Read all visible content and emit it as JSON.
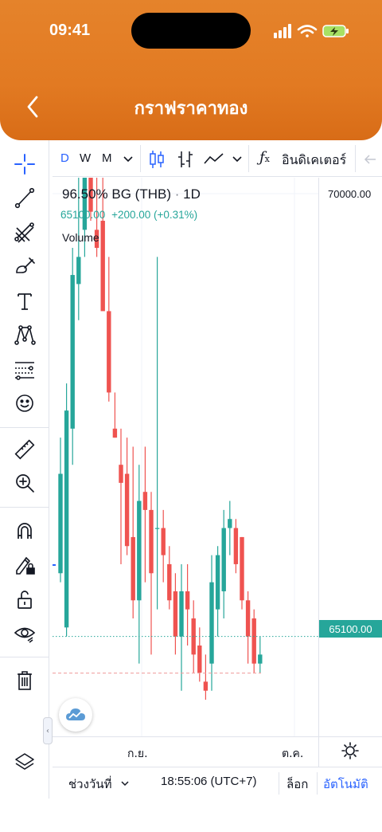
{
  "status_bar": {
    "time": "09:41"
  },
  "header": {
    "title": "กราฟราคาทอง",
    "back_icon": "chevron-left-icon"
  },
  "left_toolbar": {
    "tools": [
      "crosshair-icon",
      "trend-line-icon",
      "fib-icon",
      "brush-icon",
      "text-icon",
      "pattern-icon",
      "forecast-icon",
      "emoji-icon",
      "ruler-icon",
      "zoom-in-icon",
      "magnet-icon",
      "lock-drawing-icon",
      "unlock-icon",
      "eye-icon",
      "trash-icon",
      "layers-icon"
    ]
  },
  "top_toolbar": {
    "timeframes": [
      "D",
      "W",
      "M"
    ],
    "active_timeframe": "D",
    "indicators_label": "อินดิเคเตอร์"
  },
  "legend": {
    "symbol": "96.50% BG (THB)",
    "interval": "1D",
    "price": "65100.00",
    "change": "+200.00 (+0.31%)",
    "volume_label": "Volume"
  },
  "price_scale": {
    "top_label": "70000.00",
    "last_price_label": "65100.00"
  },
  "time_axis": {
    "labels": [
      "ก.ย.",
      "ต.ค."
    ]
  },
  "bottom_bar": {
    "range_label": "ช่วงวันที่",
    "clock": "18:55:06 (UTC+7)",
    "log_label": "ล็อก",
    "auto_label": "อัตโนมัติ"
  },
  "colors": {
    "up": "#26a69a",
    "down": "#ef5350",
    "accent": "#2962ff",
    "header": "#e27a22"
  },
  "chart_data": {
    "type": "candlestick",
    "title": "96.50% BG (THB)",
    "interval": "1D",
    "y_axis_label_shown": "70000.00",
    "last_price": 65100.0,
    "candles": [
      {
        "o": 65800,
        "h": 67300,
        "l": 65700,
        "c": 66900
      },
      {
        "o": 65200,
        "h": 67900,
        "l": 65100,
        "c": 67600
      },
      {
        "o": 67400,
        "h": 69400,
        "l": 67000,
        "c": 69100
      },
      {
        "o": 69000,
        "h": 70300,
        "l": 68600,
        "c": 69300
      },
      {
        "o": 69600,
        "h": 70400,
        "l": 69300,
        "c": 70300
      },
      {
        "o": 70300,
        "h": 70600,
        "l": 69700,
        "c": 69800
      },
      {
        "o": 69600,
        "h": 70200,
        "l": 69300,
        "c": 69400
      },
      {
        "o": 69700,
        "h": 70200,
        "l": 68800,
        "c": 68700
      },
      {
        "o": 68700,
        "h": 69300,
        "l": 67700,
        "c": 67800
      },
      {
        "o": 67400,
        "h": 67800,
        "l": 67300,
        "c": 67300
      },
      {
        "o": 67000,
        "h": 67400,
        "l": 65900,
        "c": 66800
      },
      {
        "o": 66900,
        "h": 67300,
        "l": 66000,
        "c": 66100
      },
      {
        "o": 66200,
        "h": 67200,
        "l": 65300,
        "c": 65500
      },
      {
        "o": 65500,
        "h": 67000,
        "l": 64800,
        "c": 66600
      },
      {
        "o": 66700,
        "h": 67200,
        "l": 65700,
        "c": 66500
      },
      {
        "o": 66500,
        "h": 66700,
        "l": 64900,
        "c": 65800
      },
      {
        "o": 66300,
        "h": 69300,
        "l": 65400,
        "c": 66300
      },
      {
        "o": 66300,
        "h": 66500,
        "l": 65700,
        "c": 66000
      },
      {
        "o": 65900,
        "h": 66100,
        "l": 65400,
        "c": 65500
      },
      {
        "o": 65600,
        "h": 65800,
        "l": 64900,
        "c": 65100
      },
      {
        "o": 65100,
        "h": 65900,
        "l": 64500,
        "c": 65600
      },
      {
        "o": 65600,
        "h": 65900,
        "l": 65000,
        "c": 65400
      },
      {
        "o": 65300,
        "h": 65500,
        "l": 64700,
        "c": 64900
      },
      {
        "o": 65000,
        "h": 65200,
        "l": 64600,
        "c": 64700
      },
      {
        "o": 64600,
        "h": 64900,
        "l": 64400,
        "c": 64500
      },
      {
        "o": 64800,
        "h": 66000,
        "l": 64500,
        "c": 65700
      },
      {
        "o": 65400,
        "h": 66100,
        "l": 65100,
        "c": 66000
      },
      {
        "o": 65600,
        "h": 66500,
        "l": 65300,
        "c": 66300
      },
      {
        "o": 66300,
        "h": 66600,
        "l": 66000,
        "c": 66400
      },
      {
        "o": 66300,
        "h": 66400,
        "l": 65800,
        "c": 65900
      },
      {
        "o": 66200,
        "h": 66200,
        "l": 65400,
        "c": 65500
      },
      {
        "o": 65500,
        "h": 65600,
        "l": 64800,
        "c": 65100
      },
      {
        "o": 65300,
        "h": 65400,
        "l": 64700,
        "c": 64800
      },
      {
        "o": 64800,
        "h": 65100,
        "l": 64700,
        "c": 64900
      }
    ]
  }
}
